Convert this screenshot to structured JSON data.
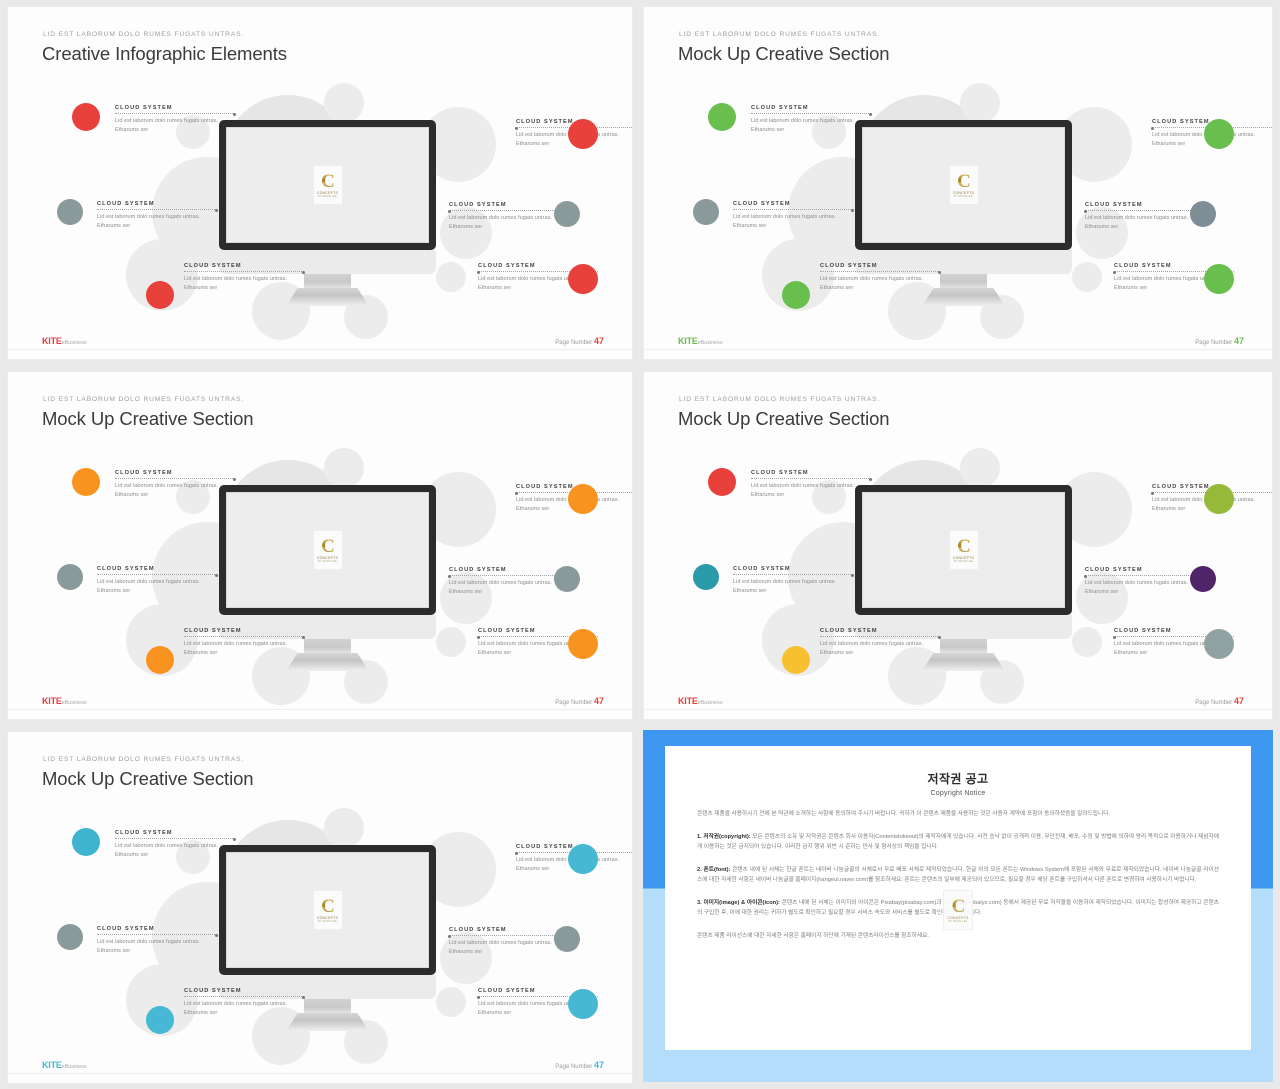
{
  "meta": {
    "eyebrow": "LID EST LABORUM DOLO RUMES FUGATS UNTRAS.",
    "callout_head": "CLOUD SYSTEM",
    "callout_body": "Lid est laborum dolo rumes fugats untras. Etharums ser",
    "brand_name": "KITE",
    "brand_suffix": "eBusiness",
    "page_label": "Page Number",
    "page_number": "47",
    "watermark": {
      "letter": "C",
      "line1": "CONCEPTS",
      "line2": "BY  MOON  LEE"
    }
  },
  "slides": [
    {
      "title": "Creative Infographic Elements",
      "accent": "#e8403a",
      "dots": [
        "#e8403a",
        "#8a9a9a",
        "#e8403a",
        "#e8403a",
        "#8a9a9a",
        "#e8403a"
      ]
    },
    {
      "title": "Mock Up Creative Section",
      "accent": "#69bf4d",
      "dots": [
        "#69bf4d",
        "#8a9a9a",
        "#69bf4d",
        "#69bf4d",
        "#7d8e97",
        "#69bf4d"
      ]
    },
    {
      "title": "Mock Up Creative Section",
      "accent": "#f8931f",
      "dots": [
        "#f8931f",
        "#8a9a9a",
        "#f8931f",
        "#f8931f",
        "#8a9a9a",
        "#f8931f"
      ]
    },
    {
      "title": "Mock Up Creative Section",
      "accent": "#e8403a",
      "dots": [
        "#e8403a",
        "#2a9aa8",
        "#f7c02e",
        "#96b93a",
        "#4f2468",
        "#8fa3a3"
      ]
    },
    {
      "title": "Mock Up Creative Section",
      "accent": "#46b8d4",
      "dots": [
        "#3fb4cf",
        "#8a9a9a",
        "#46b8d4",
        "#46b8d4",
        "#8a9a9a",
        "#46b8d4"
      ]
    }
  ],
  "copyright": {
    "title_ko": "저작권 공고",
    "title_en": "Copyright Notice",
    "intro": "콘텐츠 제품을 사용하시기 전에 본 약관에 소개하는 사항에 동의하여 주시기 바랍니다. 귀하가 이 콘텐츠 제품을 사용하는 것은 사용자 계약에 포함이 동의하셨음을 알려드립니다.",
    "sections": [
      {
        "label": "1. 저작권(copyright):",
        "text": "모든 콘텐츠의 소유 및 저작권은 콘텐츠 회사 이용자(Contentstokeout)의 제작자에게 있습니다. 사전 승낙 없이 공개적 이용, 무단전재, 배포, 수정 및 방법에 의하여 영리 목적으로 이용하거나 제삼자에게 이용하는 것은 금지되어 있습니다. 이러한 금지 행위 위반 시 준하는 민사 및 형사상의 책임을 집니다."
      },
      {
        "label": "2. 폰트(font):",
        "text": "콘텐츠 내에 된 서체는 한글 폰트는 네이버 나눔글꼴의 서체로서 무료 배포 서체로 제작되었습니다. 한글 외의 모든 폰트는 Windows System에 포함된 서체와 무료로 제작되었습니다. 네이버 나눔글꼴 라이선스에 대한 자세한 사항은 네이버 나눔글꼴 홈페이지(hangeul.naver.com)를 참조하세요. 폰트는 콘텐츠의 일부에 제공되어 있으므로, 필요할 경우 해당 폰트를 구입하셔서 다른 폰트로 변경하여 사용하시기 바랍니다."
      },
      {
        "label": "3. 이미지(image) & 아이콘(icon):",
        "text": "콘텐츠 내에 된 서체는 이미지와 아이콘은 Pixabay(pixabay.com)과 Webalys(webalys.com) 등에서 제공된 무료 저작물을 이용하여 제작되었습니다. 이미지는 합성하여 제공하고 콘텐츠의 구입한 후, 이에 대한 권리는 귀하가 별도로 확인하고 필요할 경우 서비스 속도와 서비스를 별도로 확인하시기 바랍니다."
      }
    ],
    "footer": "콘텐츠 제품 라이선스에 대한 자세한 사항은 홈페이지 하단에 기재된 콘텐츠라이선스를 참조하세요."
  }
}
